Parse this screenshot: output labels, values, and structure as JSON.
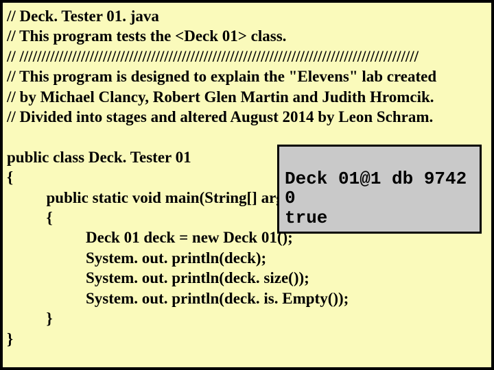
{
  "comments": {
    "l1": "// Deck. Tester 01. java",
    "l2": "// This program tests the <Deck 01> class.",
    "l3": "// ///////////////////////////////////////////////////////////////////////////////////////////",
    "l4": "// This program is designed to explain the \"Elevens\" lab created",
    "l5": "// by Michael Clancy, Robert Glen Martin and Judith Hromcik.",
    "l6": "// Divided into stages and altered August 2014 by Leon Schram."
  },
  "code": {
    "class_decl": "public class Deck. Tester 01",
    "open1": "{",
    "main_sig": "          public static void main(String[] args)",
    "open2": "          {",
    "s1": "                    Deck 01 deck = new Deck 01();",
    "s2": "                    System. out. println(deck);",
    "s3": "                    System. out. println(deck. size());",
    "s4": "                    System. out. println(deck. is. Empty());",
    "close2": "          }",
    "close1": "}"
  },
  "output": {
    "o1": "Deck 01@1 db 9742",
    "o2": "0",
    "o3": "true"
  }
}
